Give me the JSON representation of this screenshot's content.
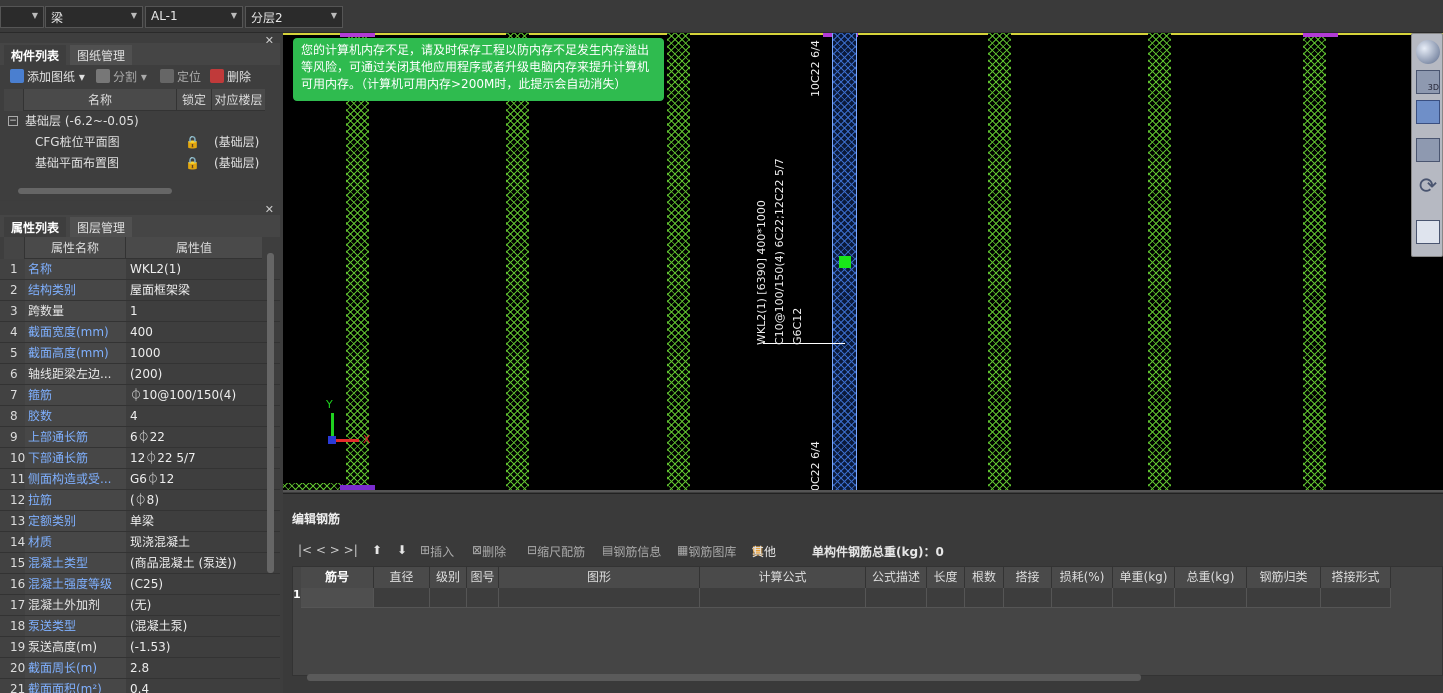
{
  "topbar": {
    "selectors": [
      {
        "label": "",
        "left": 0
      },
      {
        "label": "梁"
      },
      {
        "label": "AL-1"
      },
      {
        "label": "分层2"
      }
    ]
  },
  "drawing_panel": {
    "tabs": [
      "构件列表",
      "图纸管理"
    ],
    "tools": [
      "添加图纸",
      "分割",
      "定位",
      "删除"
    ],
    "columns": [
      "名称",
      "锁定",
      "对应楼层"
    ],
    "rows": [
      {
        "name": "基础层 (-6.2~-0.05)",
        "lock": "",
        "floor": ""
      },
      {
        "name": "CFG桩位平面图",
        "lock": "🔒",
        "floor": "(基础层)"
      },
      {
        "name": "基础平面布置图",
        "lock": "🔒",
        "floor": "(基础层)"
      }
    ]
  },
  "prop_panel": {
    "tabs": [
      "属性列表",
      "图层管理"
    ],
    "columns": [
      "属性名称",
      "属性值"
    ],
    "rows": [
      {
        "n": "1",
        "name": "名称",
        "value": "WKL2(1)",
        "blue": true
      },
      {
        "n": "2",
        "name": "结构类别",
        "value": "屋面框架梁",
        "blue": true
      },
      {
        "n": "3",
        "name": "跨数量",
        "value": "1",
        "blue": false
      },
      {
        "n": "4",
        "name": "截面宽度(mm)",
        "value": "400",
        "blue": true
      },
      {
        "n": "5",
        "name": "截面高度(mm)",
        "value": "1000",
        "blue": true
      },
      {
        "n": "6",
        "name": "轴线距梁左边...",
        "value": "(200)",
        "blue": false
      },
      {
        "n": "7",
        "name": "箍筋",
        "value": "⏀10@100/150(4)",
        "blue": true
      },
      {
        "n": "8",
        "name": "胶数",
        "value": "4",
        "blue": true
      },
      {
        "n": "9",
        "name": "上部通长筋",
        "value": "6⏀22",
        "blue": true
      },
      {
        "n": "10",
        "name": "下部通长筋",
        "value": "12⏀22 5/7",
        "blue": true
      },
      {
        "n": "11",
        "name": "侧面构造或受...",
        "value": "G6⏀12",
        "blue": true
      },
      {
        "n": "12",
        "name": "拉筋",
        "value": "(⏀8)",
        "blue": true
      },
      {
        "n": "13",
        "name": "定额类别",
        "value": "单梁",
        "blue": true
      },
      {
        "n": "14",
        "name": "材质",
        "value": "现浇混凝土",
        "blue": true
      },
      {
        "n": "15",
        "name": "混凝土类型",
        "value": "(商品混凝土 (泵送))",
        "blue": true
      },
      {
        "n": "16",
        "name": "混凝土强度等级",
        "value": "(C25)",
        "blue": true
      },
      {
        "n": "17",
        "name": "混凝土外加剂",
        "value": "(无)",
        "blue": false
      },
      {
        "n": "18",
        "name": "泵送类型",
        "value": "(混凝土泵)",
        "blue": true
      },
      {
        "n": "19",
        "name": "泵送高度(m)",
        "value": "(-1.53)",
        "blue": false
      },
      {
        "n": "20",
        "name": "截面周长(m)",
        "value": "2.8",
        "blue": true
      },
      {
        "n": "21",
        "name": "截面面积(m²)",
        "value": "0.4",
        "blue": true
      }
    ]
  },
  "canvas": {
    "notice": "您的计算机内存不足，请及时保存工程以防内存不足发生内存溢出等风险，可通过关闭其他应用程序或者升级电脑内存来提升计算机可用内存。（计算机可用内存>200M时，此提示会自动消失）",
    "beam_top_label": "10C22 6/4",
    "beam_bottom_label": "0C22 6/4",
    "beam_annotation": "WKL2(1) [6390] 400*1000",
    "beam_annotation2": "C10@100/150(4) 6C22;12C22 5/7",
    "beam_annotation3": "G6C12",
    "axis_x": "X",
    "axis_y": "Y"
  },
  "editor": {
    "title": "编辑钢筋",
    "nav": "|<  <  >  >|",
    "tools": [
      "插入",
      "删除",
      "缩尺配筋",
      "钢筋信息",
      "钢筋图库",
      "其他"
    ],
    "weight_label": "单构件钢筋总重(kg)：0",
    "columns": [
      "筋号",
      "直径(mm)",
      "级别",
      "图号",
      "图形",
      "计算公式",
      "公式描述",
      "长度",
      "根数",
      "搭接",
      "损耗(%)",
      "单重(kg)",
      "总重(kg)",
      "钢筋归类",
      "搭接形式"
    ],
    "row_number": "1"
  },
  "colors": {
    "hatch": "#5fbf2f",
    "beam": "#3a6bc8",
    "notice": "#2fbb4f",
    "marker": "#b23bd6"
  }
}
